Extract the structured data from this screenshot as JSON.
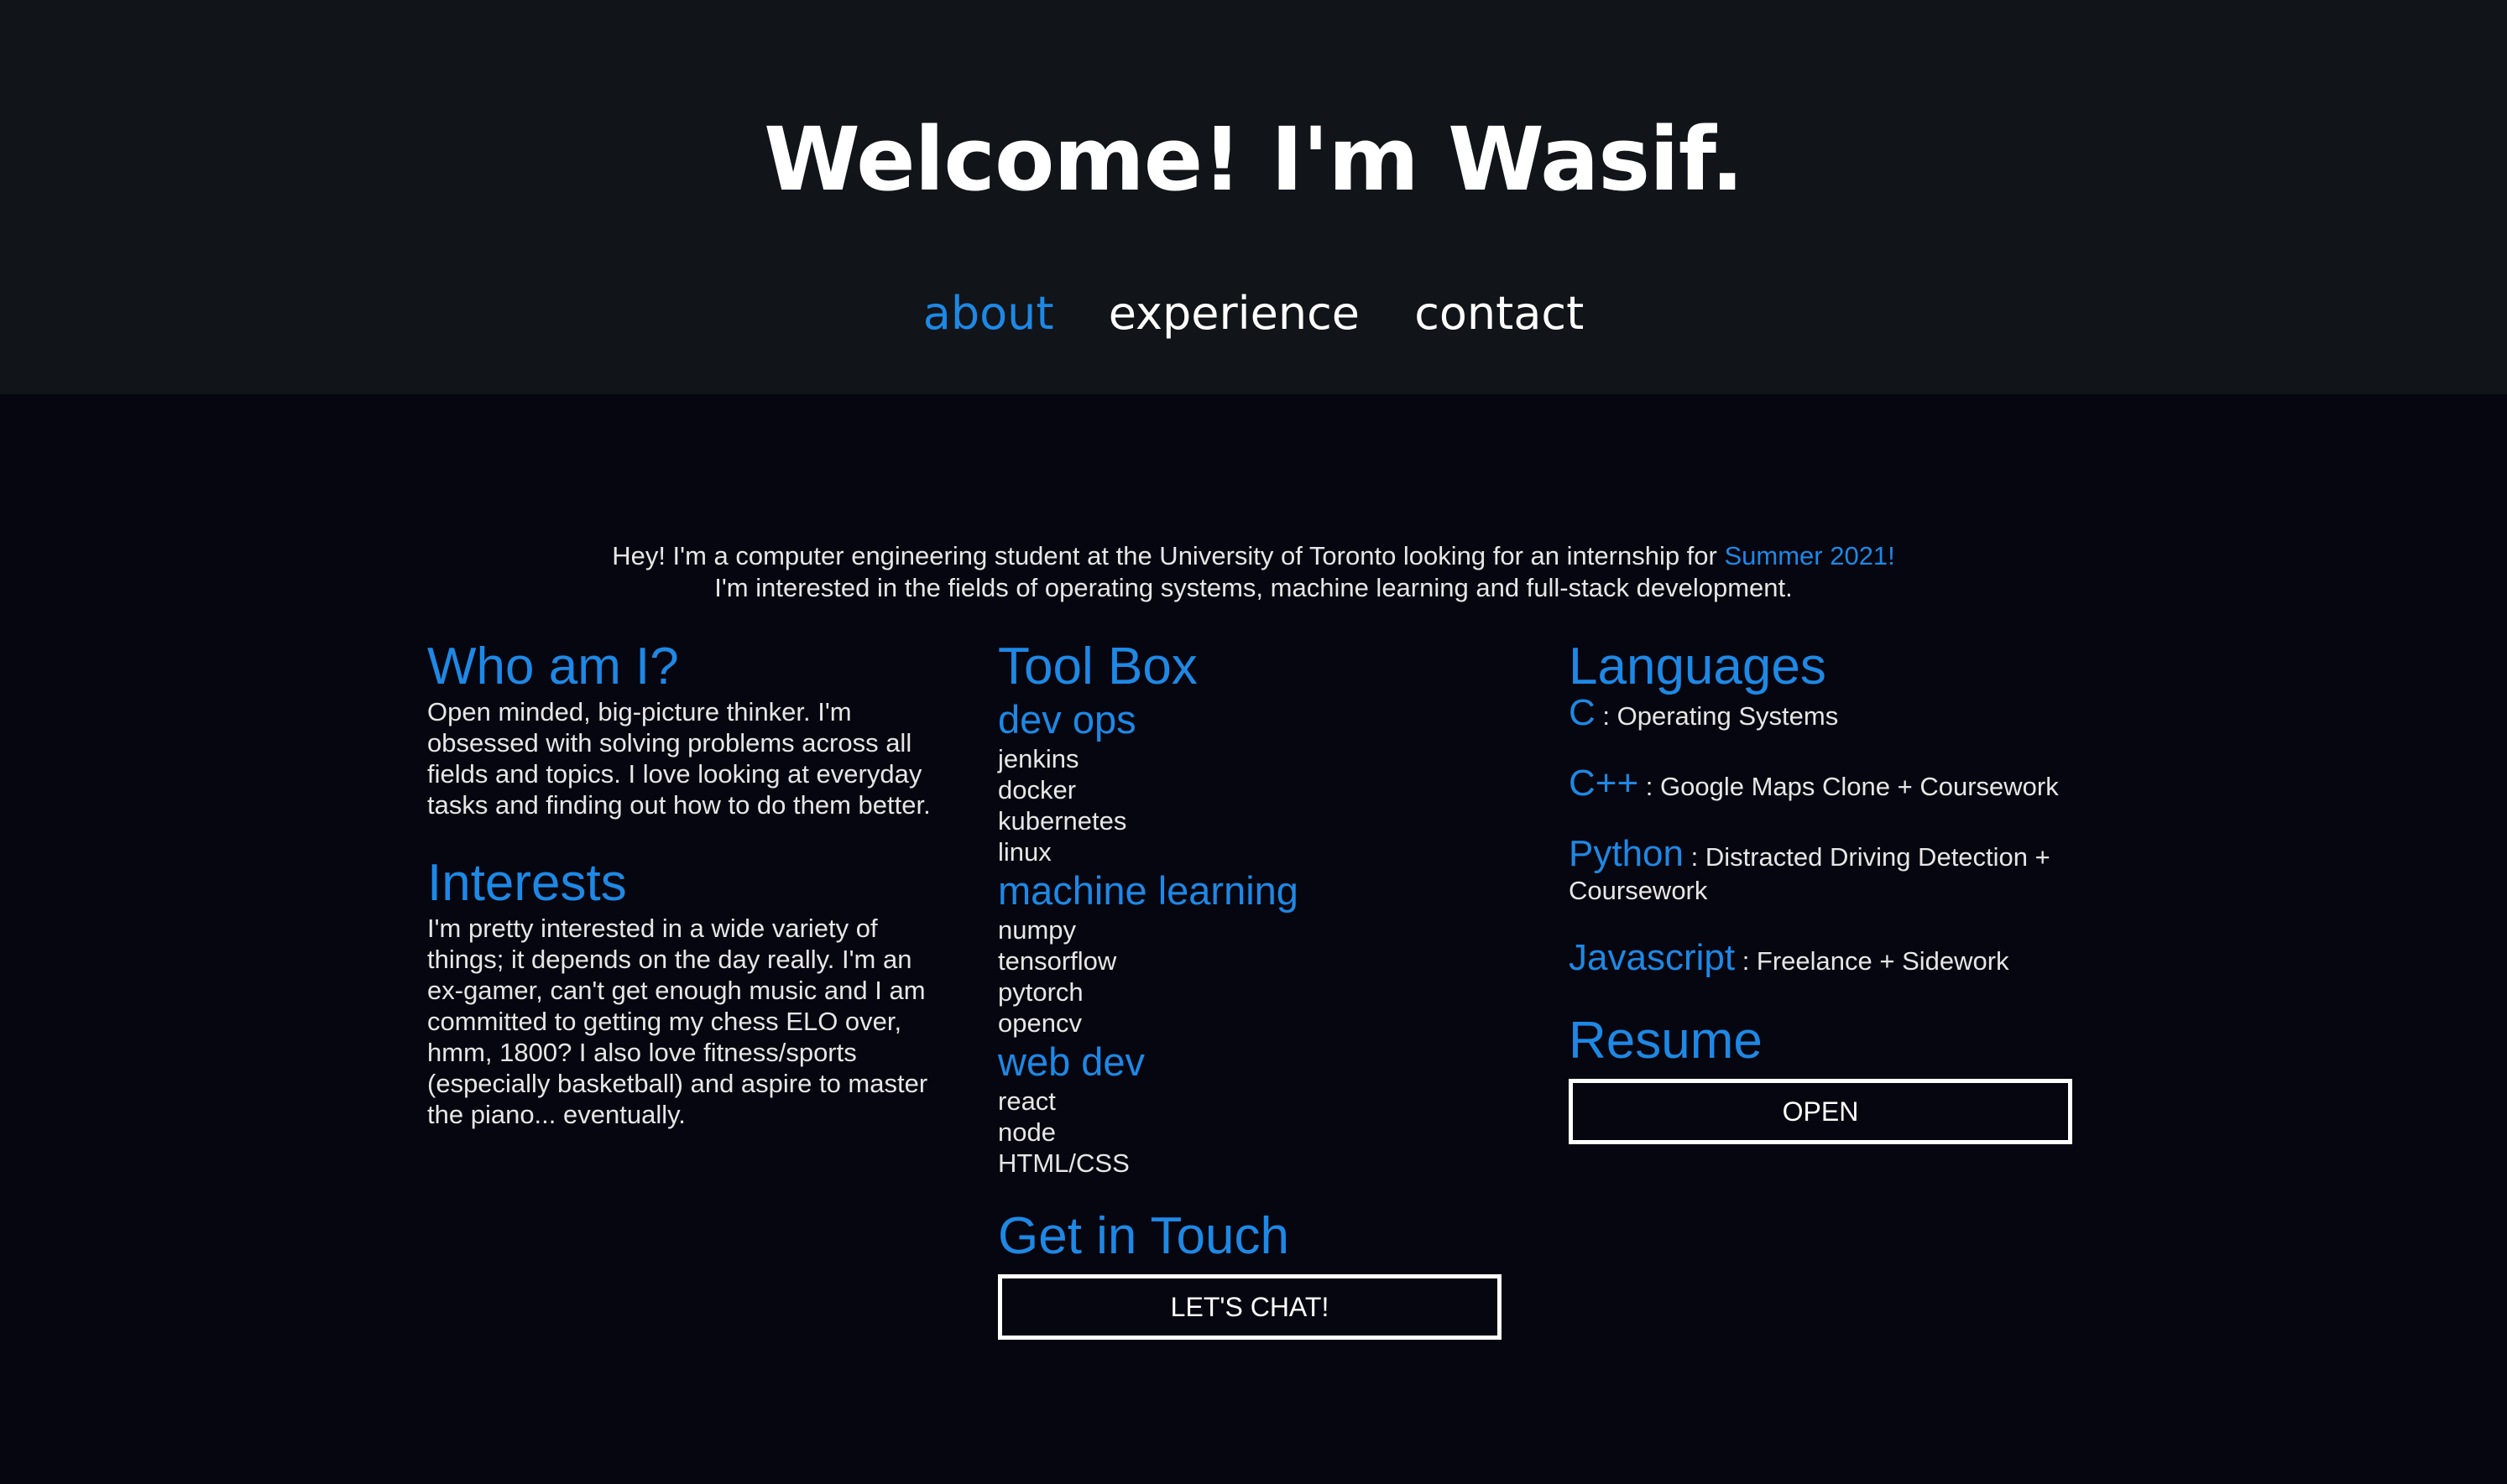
{
  "header": {
    "title": "Welcome! I'm Wasif.",
    "nav": [
      {
        "label": "about",
        "active": true
      },
      {
        "label": "experience",
        "active": false
      },
      {
        "label": "contact",
        "active": false
      }
    ]
  },
  "intro": {
    "line1_prefix": "Hey! I'm a computer engineering student at the University of Toronto looking for an internship for ",
    "line1_highlight": "Summer 2021!",
    "line2": "I'm interested in the fields of operating systems, machine learning and full-stack development."
  },
  "who": {
    "heading": "Who am I?",
    "text": "Open minded, big-picture thinker. I'm obsessed with solving problems across all fields and topics. I love looking at everyday tasks and finding out how to do them better."
  },
  "interests": {
    "heading": "Interests",
    "text": "I'm pretty interested in a wide variety of things; it depends on the day really. I'm an ex-gamer, can't get enough music and I am committed to getting my chess ELO over, hmm, 1800? I also love fitness/sports (especially basketball) and aspire to master the piano... eventually."
  },
  "toolbox": {
    "heading": "Tool Box",
    "groups": [
      {
        "title": "dev ops",
        "items": [
          "jenkins",
          "docker",
          "kubernetes",
          "linux"
        ]
      },
      {
        "title": "machine learning",
        "items": [
          "numpy",
          "tensorflow",
          "pytorch",
          "opencv"
        ]
      },
      {
        "title": "web dev",
        "items": [
          "react",
          "node",
          "HTML/CSS"
        ]
      }
    ]
  },
  "contact": {
    "heading": "Get in Touch",
    "button": "LET'S CHAT!"
  },
  "languages": {
    "heading": "Languages",
    "items": [
      {
        "name": "C",
        "desc": " : Operating Systems"
      },
      {
        "name": "C++",
        "desc": " : Google Maps Clone + Coursework"
      },
      {
        "name": "Python",
        "desc": " : Distracted Driving Detection + Coursework"
      },
      {
        "name": "Javascript",
        "desc": " : Freelance + Sidework"
      }
    ]
  },
  "resume": {
    "heading": "Resume",
    "button": "OPEN"
  },
  "colors": {
    "accent": "#1e88e5",
    "header_bg": "#111419",
    "page_bg": "#05060f",
    "text": "#e6e6e6"
  }
}
